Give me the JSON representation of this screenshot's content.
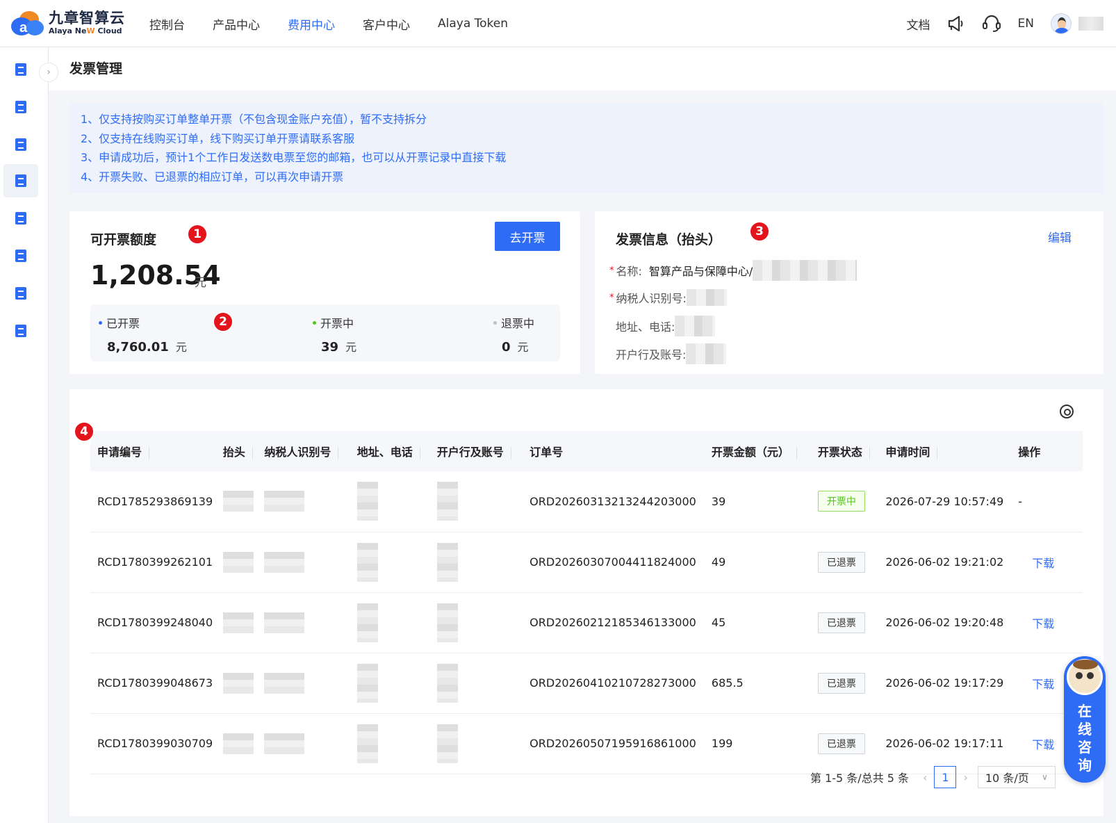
{
  "brand": {
    "name_cn": "九章智算云",
    "name_en_prefix": "Alaya Ne",
    "name_en_w": "W",
    "name_en_suffix": " Cloud"
  },
  "nav": {
    "items": [
      "控制台",
      "产品中心",
      "费用中心",
      "客户中心",
      "Alaya Token"
    ],
    "active_index": 2
  },
  "topright": {
    "docs": "文档",
    "lang": "EN"
  },
  "sidebar": {
    "items": [
      "money-bag-icon",
      "document-icon",
      "bill-icon",
      "ticket-icon",
      "receipt-icon",
      "settlement-icon",
      "archive-download-icon",
      "archive-export-icon"
    ],
    "active_index": 3
  },
  "page": {
    "title": "发票管理"
  },
  "notice": {
    "lines": [
      "1、仅支持按购买订单整单开票（不包含现金账户充值），暂不支持拆分",
      "2、仅支持在线购买订单，线下购买订单开票请联系客服",
      "3、申请成功后，预计1个工作日发送数电票至您的邮箱，也可以从开票记录中直接下载",
      "4、开票失败、已退票的相应订单，可以再次申请开票"
    ]
  },
  "quota": {
    "title": "可开票额度",
    "button": "去开票",
    "amount": "1,208.54",
    "unit": "元",
    "stats": [
      {
        "label": "已开票",
        "value": "8,760.01",
        "unit": "元",
        "color": "#2f6cf6"
      },
      {
        "label": "开票中",
        "value": "39",
        "unit": "元",
        "color": "#52c41a"
      },
      {
        "label": "退票中",
        "value": "0",
        "unit": "元",
        "color": "#bfbfbf"
      }
    ]
  },
  "invoice_info": {
    "title": "发票信息（抬头）",
    "edit": "编辑",
    "name_label": "名称:",
    "name_value": "智算产品与保障中心/",
    "taxid_label": "纳税人识别号:",
    "address_label": "地址、电话:",
    "bank_label": "开户行及账号:",
    "required_mark": "*"
  },
  "badges": [
    "1",
    "2",
    "3",
    "4"
  ],
  "table": {
    "headers": [
      "申请编号",
      "抬头",
      "纳税人识别号",
      "地址、电话",
      "开户行及账号",
      "订单号",
      "开票金额（元）",
      "开票状态",
      "申请时间",
      "操作"
    ],
    "rows": [
      {
        "id": "RCD1785293869139",
        "order": "ORD20260313213244203000",
        "amount": "39",
        "status": "开票中",
        "status_color": "green",
        "time": "2026-07-29 10:57:49",
        "action": "-"
      },
      {
        "id": "RCD1780399262101",
        "order": "ORD20260307004411824000",
        "amount": "49",
        "status": "已退票",
        "status_color": "gray",
        "time": "2026-06-02 19:21:02",
        "action": "下载"
      },
      {
        "id": "RCD1780399248040",
        "order": "ORD20260212185346133000",
        "amount": "45",
        "status": "已退票",
        "status_color": "gray",
        "time": "2026-06-02 19:20:48",
        "action": "下载"
      },
      {
        "id": "RCD1780399048673",
        "order": "ORD20260410210728273000",
        "amount": "685.5",
        "status": "已退票",
        "status_color": "gray",
        "time": "2026-06-02 19:17:29",
        "action": "下载"
      },
      {
        "id": "RCD1780399030709",
        "order": "ORD20260507195916861000",
        "amount": "199",
        "status": "已退票",
        "status_color": "gray",
        "time": "2026-06-02 19:17:11",
        "action": "下载"
      }
    ]
  },
  "pagination": {
    "summary": "第 1-5 条/总共 5 条",
    "current": "1",
    "page_size": "10 条/页"
  },
  "consult": {
    "label": "在线咨询"
  }
}
